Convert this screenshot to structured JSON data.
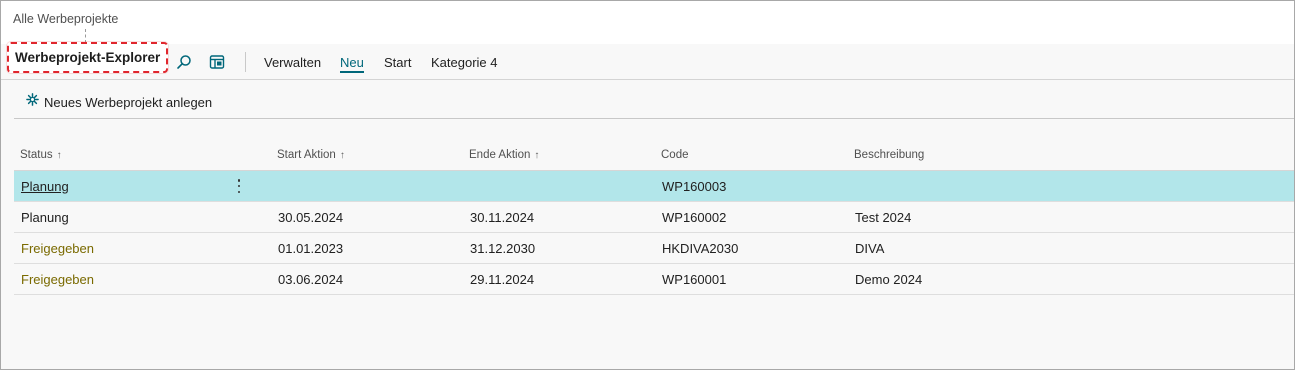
{
  "breadcrumb": "Alle Werbeprojekte",
  "page_title": "Werbeprojekt-Explorer",
  "icons": {
    "search": "search-icon",
    "view": "layout-view-icon",
    "new": "new-sparkle-icon",
    "row_menu": "more-vertical-icon"
  },
  "actionbar": {
    "menu": [
      "Verwalten",
      "Neu",
      "Start",
      "Kategorie 4"
    ],
    "active": "Neu"
  },
  "new_action_label": "Neues Werbeprojekt anlegen",
  "colors": {
    "accent": "#00677a",
    "selected_row": "#b2e6ea",
    "released_text": "#7a6a00",
    "highlight_border": "#e0262d"
  },
  "table": {
    "columns": [
      {
        "label": "Status",
        "sorted": true,
        "sort_glyph": "↑"
      },
      {
        "label": "Start Aktion",
        "sorted": true,
        "sort_glyph": "↑"
      },
      {
        "label": "Ende Aktion",
        "sorted": true,
        "sort_glyph": "↑"
      },
      {
        "label": "Code",
        "sorted": false,
        "sort_glyph": ""
      },
      {
        "label": "Beschreibung",
        "sorted": false,
        "sort_glyph": ""
      }
    ],
    "rows": [
      {
        "status": "Planung",
        "start": "",
        "end": "",
        "code": "WP160003",
        "desc": "",
        "selected": true
      },
      {
        "status": "Planung",
        "start": "30.05.2024",
        "end": "30.11.2024",
        "code": "WP160002",
        "desc": "Test 2024",
        "selected": false
      },
      {
        "status": "Freigegeben",
        "start": "01.01.2023",
        "end": "31.12.2030",
        "code": "HKDIVA2030",
        "desc": "DIVA",
        "selected": false
      },
      {
        "status": "Freigegeben",
        "start": "03.06.2024",
        "end": "29.11.2024",
        "code": "WP160001",
        "desc": "Demo 2024",
        "selected": false
      }
    ]
  }
}
